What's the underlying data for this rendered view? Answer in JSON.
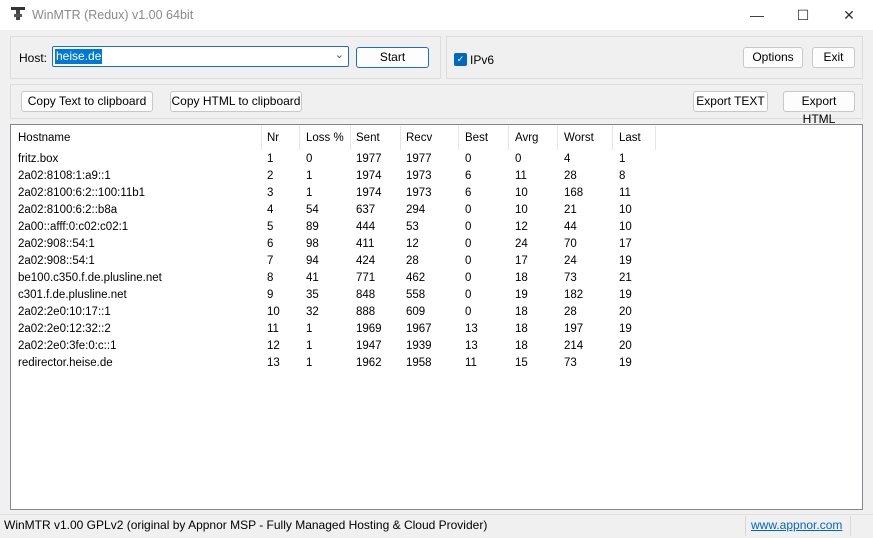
{
  "window": {
    "title": "WinMTR (Redux) v1.00 64bit",
    "minimize": "—",
    "maximize": "☐",
    "close": "✕"
  },
  "host": {
    "label": "Host:",
    "value": "heise.de",
    "start_label": "Start"
  },
  "options": {
    "ipv6_label": "IPv6",
    "ipv6_checked": true,
    "options_label": "Options",
    "exit_label": "Exit"
  },
  "toolbar": {
    "copy_text": "Copy Text to clipboard",
    "copy_html": "Copy HTML to clipboard",
    "export_text": "Export TEXT",
    "export_html": "Export HTML"
  },
  "table": {
    "columns": [
      "Hostname",
      "Nr",
      "Loss %",
      "Sent",
      "Recv",
      "Best",
      "Avrg",
      "Worst",
      "Last"
    ],
    "rows": [
      [
        "fritz.box",
        "1",
        "0",
        "1977",
        "1977",
        "0",
        "0",
        "4",
        "1"
      ],
      [
        "2a02:8108:1:a9::1",
        "2",
        "1",
        "1974",
        "1973",
        "6",
        "11",
        "28",
        "8"
      ],
      [
        "2a02:8100:6:2::100:11b1",
        "3",
        "1",
        "1974",
        "1973",
        "6",
        "10",
        "168",
        "11"
      ],
      [
        "2a02:8100:6:2::b8a",
        "4",
        "54",
        "637",
        "294",
        "0",
        "10",
        "21",
        "10"
      ],
      [
        "2a00::afff:0:c02:c02:1",
        "5",
        "89",
        "444",
        "53",
        "0",
        "12",
        "44",
        "10"
      ],
      [
        "2a02:908::54:1",
        "6",
        "98",
        "411",
        "12",
        "0",
        "24",
        "70",
        "17"
      ],
      [
        "2a02:908::54:1",
        "7",
        "94",
        "424",
        "28",
        "0",
        "17",
        "24",
        "19"
      ],
      [
        "be100.c350.f.de.plusline.net",
        "8",
        "41",
        "771",
        "462",
        "0",
        "18",
        "73",
        "21"
      ],
      [
        "c301.f.de.plusline.net",
        "9",
        "35",
        "848",
        "558",
        "0",
        "19",
        "182",
        "19"
      ],
      [
        "2a02:2e0:10:17::1",
        "10",
        "32",
        "888",
        "609",
        "0",
        "18",
        "28",
        "20"
      ],
      [
        "2a02:2e0:12:32::2",
        "11",
        "1",
        "1969",
        "1967",
        "13",
        "18",
        "197",
        "19"
      ],
      [
        "2a02:2e0:3fe:0:c::1",
        "12",
        "1",
        "1947",
        "1939",
        "13",
        "18",
        "214",
        "20"
      ],
      [
        "redirector.heise.de",
        "13",
        "1",
        "1962",
        "1958",
        "11",
        "15",
        "73",
        "19"
      ]
    ]
  },
  "status": {
    "text": "WinMTR v1.00 GPLv2 (original by Appnor MSP - Fully Managed Hosting & Cloud Provider)",
    "link": "www.appnor.com"
  },
  "colors": {
    "accent": "#0078d7",
    "link": "#0066cc"
  }
}
